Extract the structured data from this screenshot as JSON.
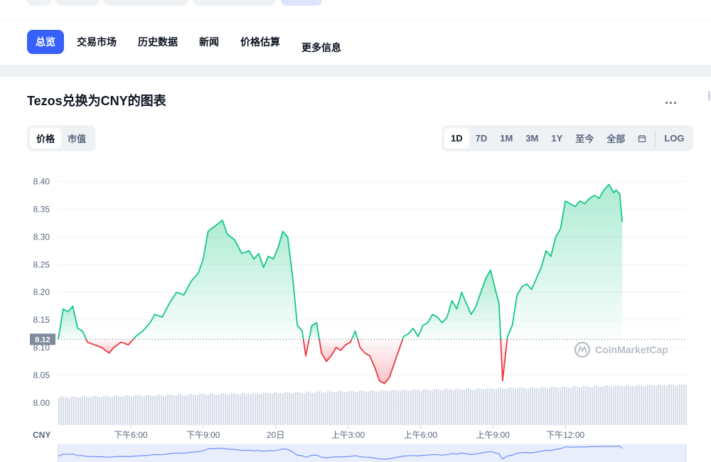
{
  "tabs": [
    {
      "label": "总览",
      "active": true
    },
    {
      "label": "交易市场"
    },
    {
      "label": "历史数据"
    },
    {
      "label": "新闻"
    },
    {
      "label": "价格估算"
    },
    {
      "label": "更多信息"
    }
  ],
  "chart_title": "Tezos兑换为CNY的图表",
  "more_label": "...",
  "view_toggle": [
    {
      "label": "价格",
      "selected": true
    },
    {
      "label": "市值"
    }
  ],
  "ranges": [
    {
      "label": "1D",
      "selected": true
    },
    {
      "label": "7D"
    },
    {
      "label": "1M"
    },
    {
      "label": "3M"
    },
    {
      "label": "1Y"
    },
    {
      "label": "至今"
    },
    {
      "label": "全部"
    }
  ],
  "log_label": "LOG",
  "watermark": "CoinMarketCap",
  "colors": {
    "up": "#16c784",
    "down": "#ea3943",
    "accent": "#3861fb",
    "volume": "#cfd6e4"
  },
  "chart_data": {
    "type": "line",
    "currency_label": "CNY",
    "baseline": 8.115,
    "baseline_label": "8.12",
    "ylim": [
      7.96,
      8.42
    ],
    "yticks": [
      8.0,
      8.05,
      8.1,
      8.15,
      8.2,
      8.25,
      8.3,
      8.35,
      8.4
    ],
    "xlim": [
      0,
      26
    ],
    "xticks": [
      {
        "x": 3,
        "label": "下午6:00"
      },
      {
        "x": 6,
        "label": "下午9:00"
      },
      {
        "x": 9,
        "label": "20日"
      },
      {
        "x": 12,
        "label": "上午3:00"
      },
      {
        "x": 15,
        "label": "上午6:00"
      },
      {
        "x": 18,
        "label": "上午9:00"
      },
      {
        "x": 21,
        "label": "下午12:00"
      }
    ],
    "series": [
      {
        "values": [
          [
            0.0,
            8.115
          ],
          [
            0.2,
            8.17
          ],
          [
            0.4,
            8.165
          ],
          [
            0.6,
            8.175
          ],
          [
            0.8,
            8.135
          ],
          [
            1.0,
            8.13
          ],
          [
            1.2,
            8.11
          ],
          [
            1.5,
            8.105
          ],
          [
            1.8,
            8.1
          ],
          [
            2.1,
            8.09
          ],
          [
            2.3,
            8.1
          ],
          [
            2.6,
            8.11
          ],
          [
            2.9,
            8.105
          ],
          [
            3.2,
            8.12
          ],
          [
            3.5,
            8.13
          ],
          [
            3.8,
            8.145
          ],
          [
            4.0,
            8.16
          ],
          [
            4.3,
            8.155
          ],
          [
            4.6,
            8.18
          ],
          [
            4.9,
            8.2
          ],
          [
            5.2,
            8.195
          ],
          [
            5.5,
            8.22
          ],
          [
            5.8,
            8.235
          ],
          [
            6.0,
            8.26
          ],
          [
            6.2,
            8.31
          ],
          [
            6.5,
            8.32
          ],
          [
            6.8,
            8.33
          ],
          [
            7.0,
            8.305
          ],
          [
            7.3,
            8.295
          ],
          [
            7.6,
            8.27
          ],
          [
            7.9,
            8.275
          ],
          [
            8.1,
            8.26
          ],
          [
            8.3,
            8.27
          ],
          [
            8.5,
            8.245
          ],
          [
            8.7,
            8.265
          ],
          [
            8.9,
            8.26
          ],
          [
            9.1,
            8.28
          ],
          [
            9.3,
            8.31
          ],
          [
            9.5,
            8.3
          ],
          [
            9.7,
            8.23
          ],
          [
            9.9,
            8.14
          ],
          [
            10.1,
            8.13
          ],
          [
            10.25,
            8.085
          ],
          [
            10.5,
            8.14
          ],
          [
            10.7,
            8.145
          ],
          [
            10.9,
            8.09
          ],
          [
            11.1,
            8.075
          ],
          [
            11.3,
            8.085
          ],
          [
            11.5,
            8.1
          ],
          [
            11.7,
            8.095
          ],
          [
            11.9,
            8.105
          ],
          [
            12.1,
            8.11
          ],
          [
            12.3,
            8.13
          ],
          [
            12.5,
            8.1
          ],
          [
            12.7,
            8.09
          ],
          [
            12.9,
            8.085
          ],
          [
            13.1,
            8.065
          ],
          [
            13.3,
            8.04
          ],
          [
            13.5,
            8.035
          ],
          [
            13.7,
            8.045
          ],
          [
            13.9,
            8.07
          ],
          [
            14.1,
            8.095
          ],
          [
            14.3,
            8.12
          ],
          [
            14.5,
            8.125
          ],
          [
            14.7,
            8.135
          ],
          [
            14.9,
            8.12
          ],
          [
            15.1,
            8.14
          ],
          [
            15.3,
            8.145
          ],
          [
            15.5,
            8.16
          ],
          [
            15.7,
            8.155
          ],
          [
            15.9,
            8.145
          ],
          [
            16.1,
            8.155
          ],
          [
            16.3,
            8.185
          ],
          [
            16.5,
            8.17
          ],
          [
            16.7,
            8.2
          ],
          [
            16.9,
            8.18
          ],
          [
            17.1,
            8.16
          ],
          [
            17.3,
            8.175
          ],
          [
            17.5,
            8.2
          ],
          [
            17.7,
            8.225
          ],
          [
            17.9,
            8.24
          ],
          [
            18.1,
            8.205
          ],
          [
            18.25,
            8.18
          ],
          [
            18.4,
            8.04
          ],
          [
            18.6,
            8.12
          ],
          [
            18.8,
            8.14
          ],
          [
            19.0,
            8.195
          ],
          [
            19.2,
            8.21
          ],
          [
            19.4,
            8.215
          ],
          [
            19.6,
            8.205
          ],
          [
            19.8,
            8.225
          ],
          [
            20.0,
            8.245
          ],
          [
            20.2,
            8.275
          ],
          [
            20.4,
            8.265
          ],
          [
            20.6,
            8.3
          ],
          [
            20.8,
            8.315
          ],
          [
            21.0,
            8.365
          ],
          [
            21.2,
            8.36
          ],
          [
            21.4,
            8.355
          ],
          [
            21.6,
            8.365
          ],
          [
            21.8,
            8.36
          ],
          [
            22.0,
            8.37
          ],
          [
            22.2,
            8.375
          ],
          [
            22.4,
            8.37
          ],
          [
            22.6,
            8.385
          ],
          [
            22.8,
            8.395
          ],
          [
            23.0,
            8.38
          ],
          [
            23.1,
            8.385
          ],
          [
            23.25,
            8.378
          ],
          [
            23.35,
            8.327
          ]
        ]
      }
    ],
    "volume": "present",
    "legend": "none",
    "grid": true
  }
}
